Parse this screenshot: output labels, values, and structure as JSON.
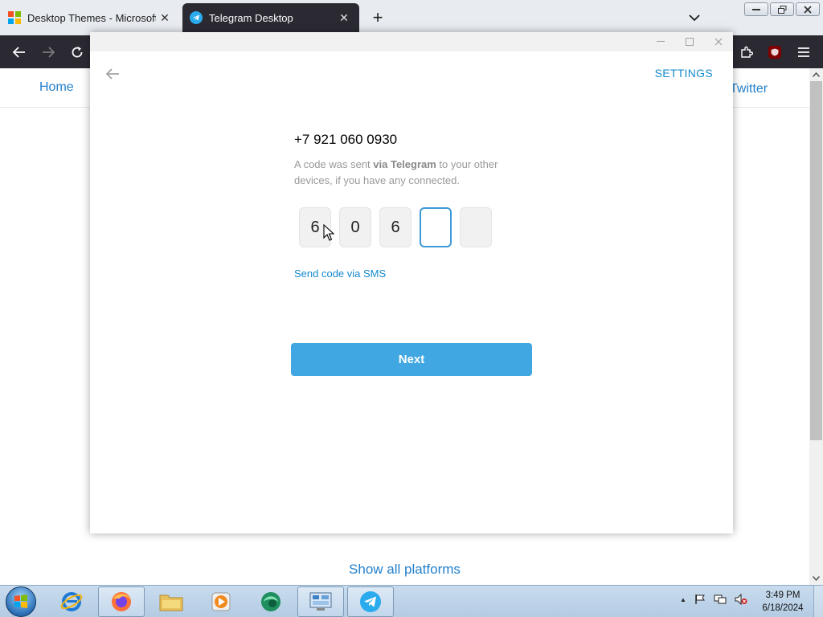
{
  "browser": {
    "tabs": [
      {
        "title": "Desktop Themes - Microsoft Su",
        "icon": "microsoft-logo-icon"
      },
      {
        "title": "Telegram Desktop",
        "icon": "telegram-icon"
      }
    ],
    "close_glyph": "✕",
    "new_tab_glyph": "+"
  },
  "webpage": {
    "nav_home": "Home",
    "nav_twitter": "Twitter",
    "show_all": "Show all platforms"
  },
  "telegram": {
    "settings": "SETTINGS",
    "phone": "+7 921 060 0930",
    "desc_part1": "A code was sent ",
    "desc_bold": "via Telegram",
    "desc_part2": " to your other devices, if you have any connected.",
    "code_digits": [
      "6",
      "0",
      "6",
      "",
      ""
    ],
    "send_sms": "Send code via SMS",
    "next": "Next"
  },
  "taskbar": {
    "time": "3:49 PM",
    "date": "6/18/2024",
    "tray_up": "▲"
  },
  "colors": {
    "accent": "#40a7e3",
    "link": "#168acd",
    "browser_dark": "#2b2a33"
  }
}
